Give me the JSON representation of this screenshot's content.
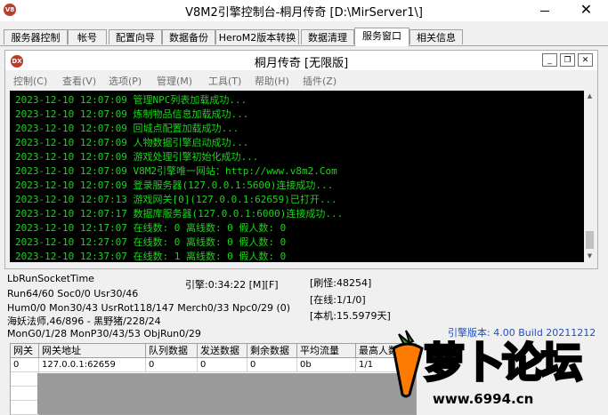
{
  "window": {
    "title": "V8M2引擎控制台-桐月传奇 [D:\\MirServer1\\]",
    "close_glyph": "✕"
  },
  "tabs": [
    "服务器控制",
    "帐号",
    "配置向导",
    "数据备份",
    "HeroM2版本转换",
    "数据清理",
    "服务窗口",
    "相关信息"
  ],
  "active_tab": "服务窗口",
  "inner": {
    "logo": "DX",
    "title": "桐月传奇 [无限版]",
    "menus": [
      "控制(C)",
      "查看(V)",
      "选项(P)",
      "管理(M)",
      "工具(T)",
      "帮助(H)",
      "插件(Z)"
    ]
  },
  "logs": [
    "2023-12-10 12:07:09 管理NPC列表加载成功...",
    "2023-12-10 12:07:09 炼制物品信息加载成功...",
    "2023-12-10 12:07:09 回城点配置加载成功...",
    "2023-12-10 12:07:09 人物数据引擎启动成功...",
    "2023-12-10 12:07:09 游戏处理引擎初始化成功...",
    "2023-12-10 12:07:09 V8M2引擎唯一网站：http://www.v8m2.Com",
    "2023-12-10 12:07:09 登录服务器(127.0.0.1:5600)连接成功...",
    "2023-12-10 12:07:13 游戏网关[0](127.0.0.1:62659)已打开...",
    "2023-12-10 12:07:17 数据库服务器(127.0.0.1:6000)连接成功...",
    "2023-12-10 12:17:07 在线数: 0 离线数: 0 假人数: 0",
    "2023-12-10 12:27:07 在线数: 0 离线数: 0 假人数: 0",
    "2023-12-10 12:37:07 在线数: 1 离线数: 0 假人数: 0"
  ],
  "stats": {
    "line1": "LbRunSocketTime",
    "line2": "Run64/60 Soc0/0 Usr30/46",
    "line3": "Hum0/0 Mon30/43 UsrRot118/147 Merch0/33 Npc0/29 (0)",
    "line4": "海妖法师,46/896 - 黑野猪/228/24",
    "line5": "MonG0/1/28 MonP30/43/53 ObjRun0/29",
    "engine": "引擎:0:34:22 [M][F]",
    "refresh_monster": "[刷怪:48254]",
    "online": "[在线:1/1/0]",
    "local": "[本机:15.5979天]"
  },
  "version": "引擎版本: 4.00 Build 20211212",
  "grid": {
    "headers": [
      "网关",
      "网关地址",
      "队列数据",
      "发送数据",
      "剩余数据",
      "平均流量",
      "最高人数"
    ],
    "rows": [
      [
        "0",
        "127.0.0.1:62659",
        "0",
        "0",
        "0",
        "0b",
        "1/1"
      ]
    ]
  },
  "watermark": {
    "text": "萝卜论坛",
    "url": "www.6994.cn"
  },
  "colors": {
    "console_bg": "#000000",
    "console_text": "#18d818",
    "tab_border": "#a0a0a0",
    "version_text": "#1f4fbf",
    "watermark": "#ffb300"
  }
}
